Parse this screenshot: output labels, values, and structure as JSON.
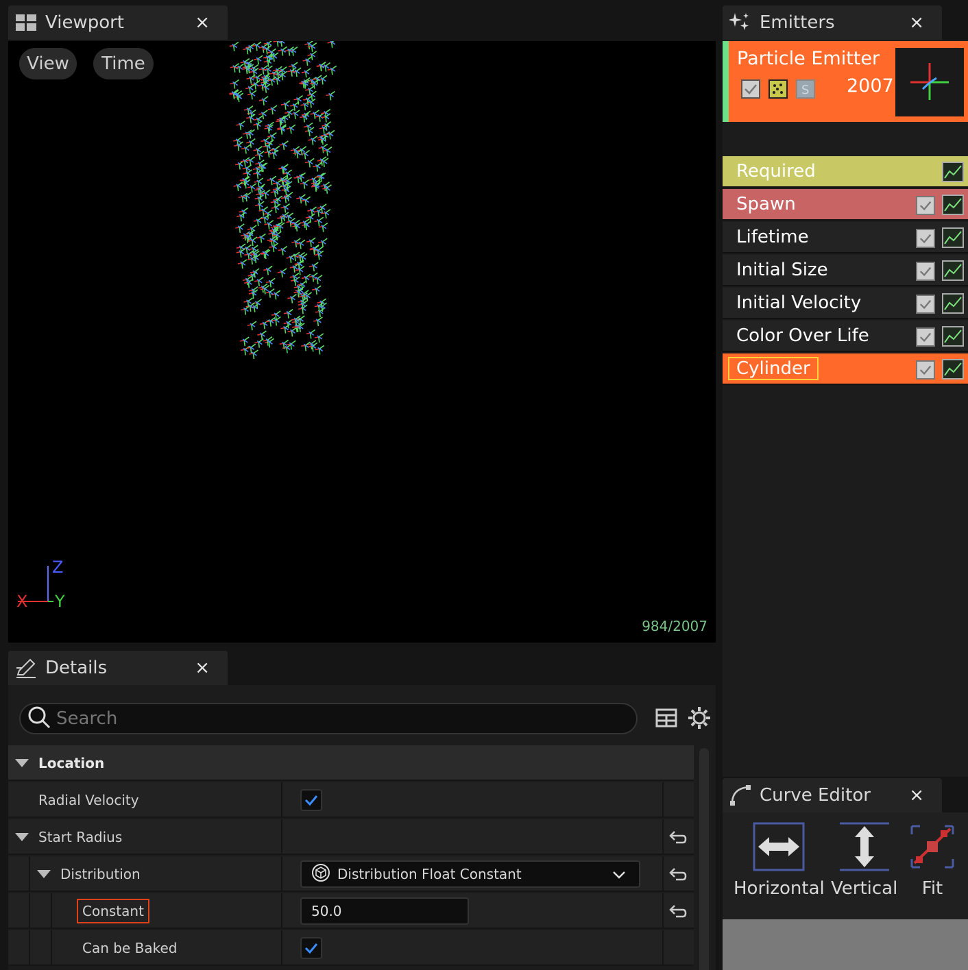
{
  "viewport": {
    "tab_title": "Viewport",
    "close": "×",
    "buttons": {
      "view": "View",
      "time": "Time"
    },
    "axis": {
      "z": "Z",
      "x": "X",
      "y": "Y"
    },
    "particle_count": "984/2007"
  },
  "emitters": {
    "tab_title": "Emitters",
    "close": "×",
    "emitter": {
      "name": "Particle Emitter",
      "count": "2007",
      "color": "#ff6a2a"
    },
    "modules": [
      {
        "label": "Required",
        "color": "#c8c864",
        "text_color": "#ffffff"
      },
      {
        "label": "Spawn",
        "color": "#c86464"
      },
      {
        "label": "Lifetime",
        "color": "#232323"
      },
      {
        "label": "Initial Size",
        "color": "#232323"
      },
      {
        "label": "Initial Velocity",
        "color": "#232323"
      },
      {
        "label": "Color Over Life",
        "color": "#232323"
      },
      {
        "label": "Cylinder",
        "color": "#ff6a2a"
      }
    ]
  },
  "details": {
    "tab_title": "Details",
    "close": "×",
    "search_placeholder": "Search",
    "rows": {
      "location": "Location",
      "radial_velocity": "Radial Velocity",
      "start_radius": "Start Radius",
      "distribution": "Distribution",
      "distribution_value": "Distribution Float Constant",
      "constant": "Constant",
      "constant_value": "50.0",
      "can_be_baked": "Can be Baked"
    }
  },
  "curve_editor": {
    "tab_title": "Curve Editor",
    "close": "×",
    "buttons": {
      "horizontal": "Horizontal",
      "vertical": "Vertical",
      "fit": "Fit"
    }
  }
}
